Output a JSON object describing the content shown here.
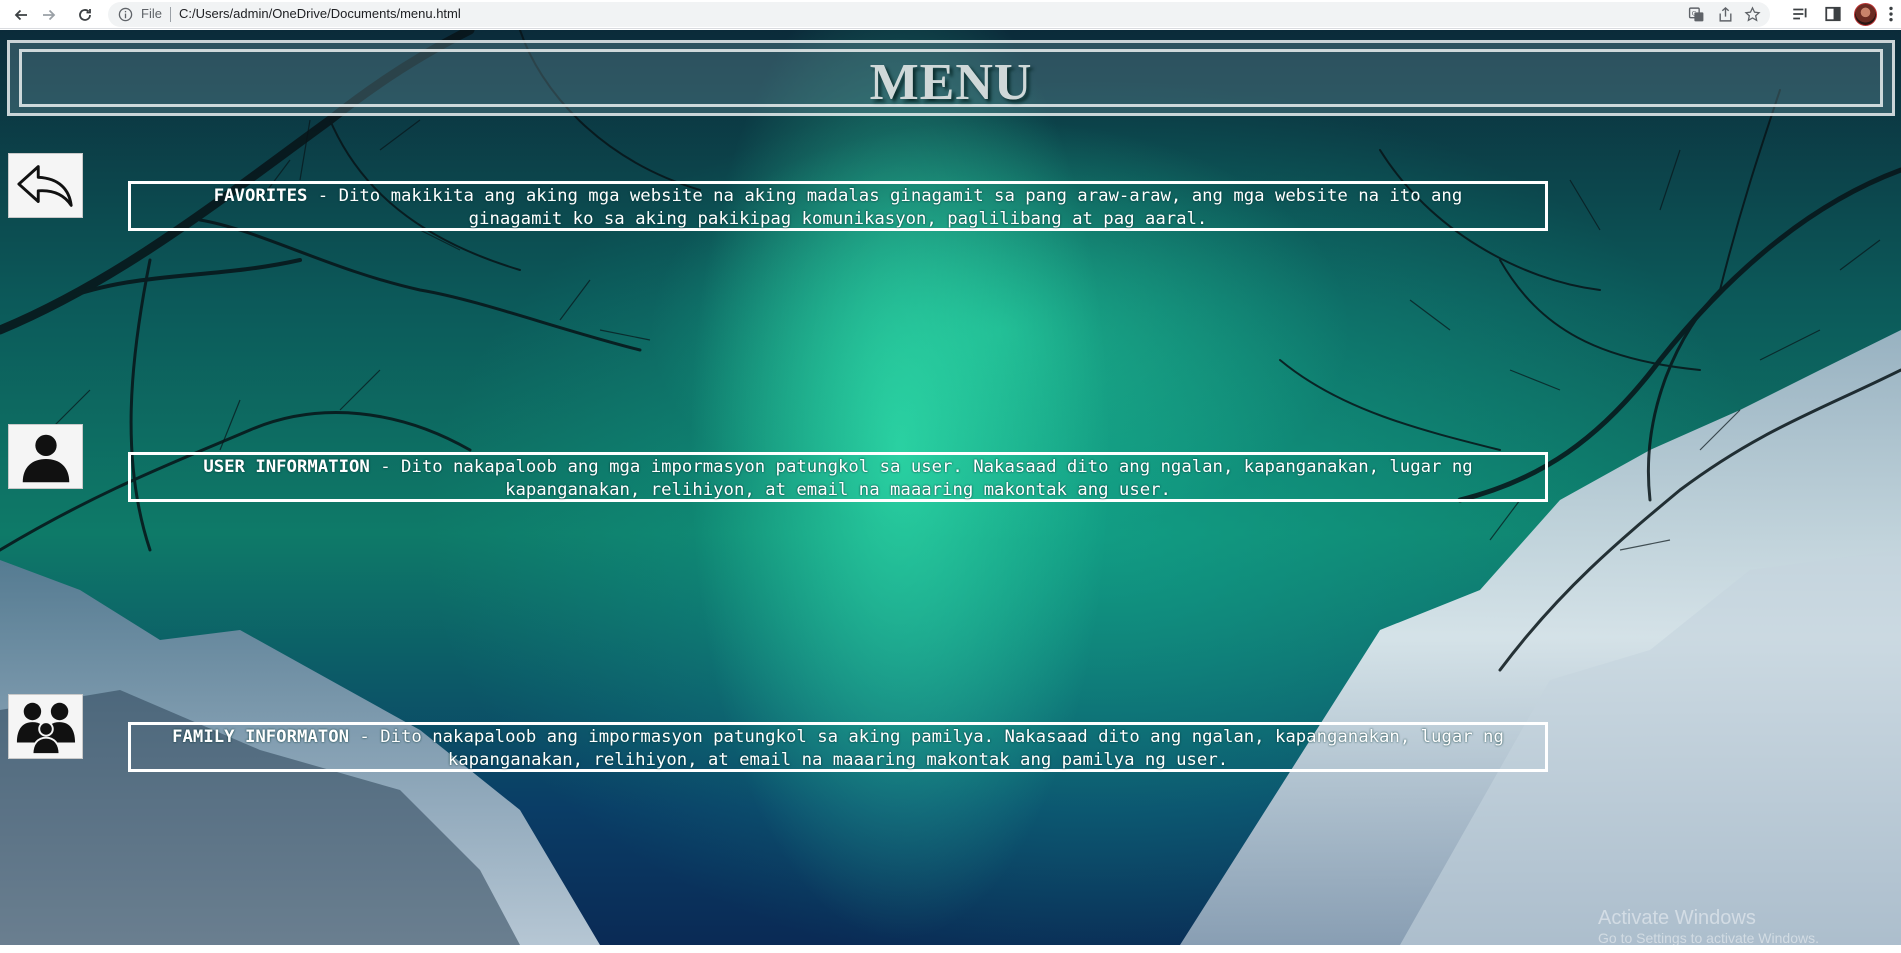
{
  "browser": {
    "file_label": "File",
    "url": "C:/Users/admin/OneDrive/Documents/menu.html"
  },
  "page": {
    "title": "MENU",
    "items": [
      {
        "icon": "back-arrow-icon",
        "label": "FAVORITES",
        "line1_rest": " - Dito makikita ang aking mga website na aking madalas ginagamit sa pang araw-araw, ang mga website na ito ang",
        "line2": "ginagamit ko sa aking pakikipag komunikasyon, paglilibang at pag aaral."
      },
      {
        "icon": "user-icon",
        "label": "USER INFORMATION",
        "line1_rest": " - Dito nakapaloob ang mga impormasyon patungkol sa user. Nakasaad dito ang ngalan, kapanganakan, lugar ng",
        "line2": "kapanganakan, relihiyon, at email na maaaring makontak ang user."
      },
      {
        "icon": "family-icon",
        "label": "FAMILY INFORMATON",
        "line1_rest": " - Dito nakapaloob ang impormasyon patungkol sa aking pamilya. Nakasaad dito ang ngalan, kapanganakan, lugar ng",
        "line2": "kapanganakan, relihiyon, at email na maaaring makontak ang pamilya ng user."
      }
    ]
  },
  "watermark": {
    "line1": "Activate Windows",
    "line2": "Go to Settings to activate Windows."
  },
  "colors": {
    "box_border": "#ffffff",
    "title": "#cfd8d8",
    "aurora": "#1fe0a0"
  }
}
